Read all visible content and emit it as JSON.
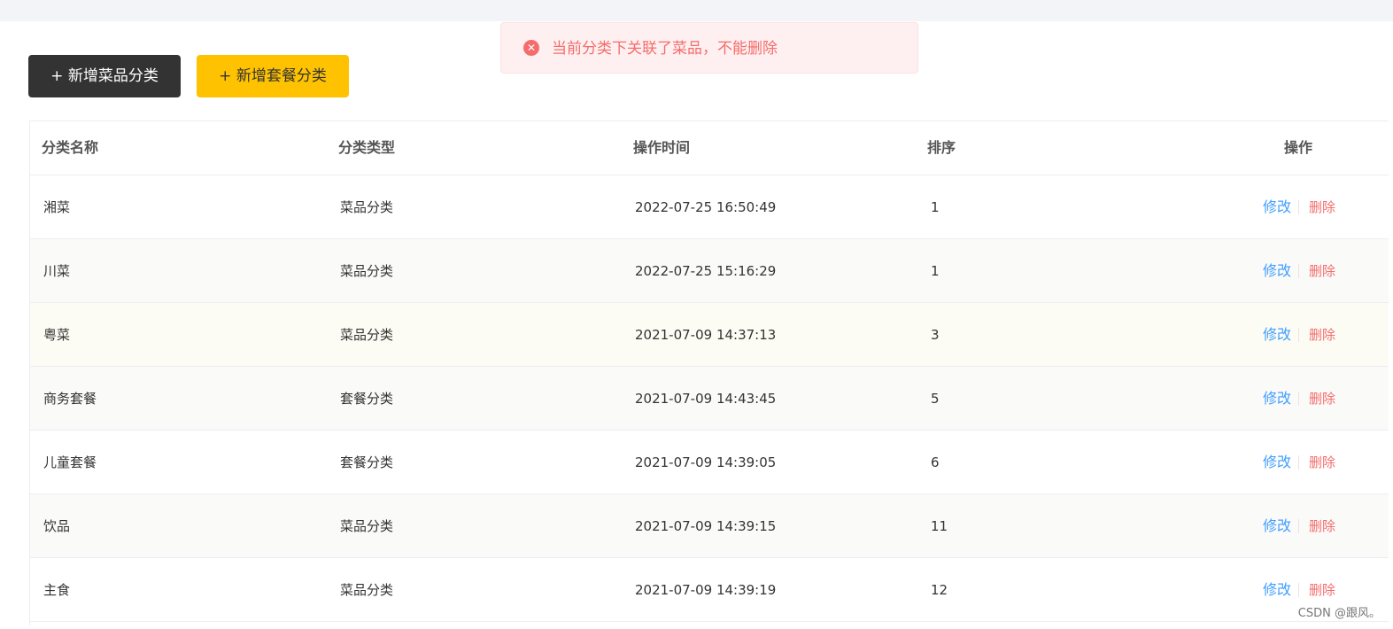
{
  "toolbar": {
    "add_dish_category_label": "+ 新增菜品分类",
    "add_combo_category_label": "+ 新增套餐分类"
  },
  "toast": {
    "icon": "error-circle-icon",
    "message": "当前分类下关联了菜品，不能删除",
    "color": "#f56c6c"
  },
  "table": {
    "columns": [
      "分类名称",
      "分类类型",
      "操作时间",
      "排序",
      "操作"
    ],
    "rows": [
      {
        "name": "湘菜",
        "type": "菜品分类",
        "time": "2022-07-25 16:50:49",
        "sort": "1"
      },
      {
        "name": "川菜",
        "type": "菜品分类",
        "time": "2022-07-25 15:16:29",
        "sort": "1"
      },
      {
        "name": "粤菜",
        "type": "菜品分类",
        "time": "2021-07-09 14:37:13",
        "sort": "3"
      },
      {
        "name": "商务套餐",
        "type": "套餐分类",
        "time": "2021-07-09 14:43:45",
        "sort": "5"
      },
      {
        "name": "儿童套餐",
        "type": "套餐分类",
        "time": "2021-07-09 14:39:05",
        "sort": "6"
      },
      {
        "name": "饮品",
        "type": "菜品分类",
        "time": "2021-07-09 14:39:15",
        "sort": "11"
      },
      {
        "name": "主食",
        "type": "菜品分类",
        "time": "2021-07-09 14:39:19",
        "sort": "12"
      }
    ],
    "actions": {
      "edit": "修改",
      "delete": "删除"
    }
  },
  "watermark": "CSDN @跟风。",
  "colors": {
    "primary_dark": "#333333",
    "accent_yellow": "#ffc200",
    "link_blue": "#419eff",
    "danger_red": "#f56c6c"
  }
}
